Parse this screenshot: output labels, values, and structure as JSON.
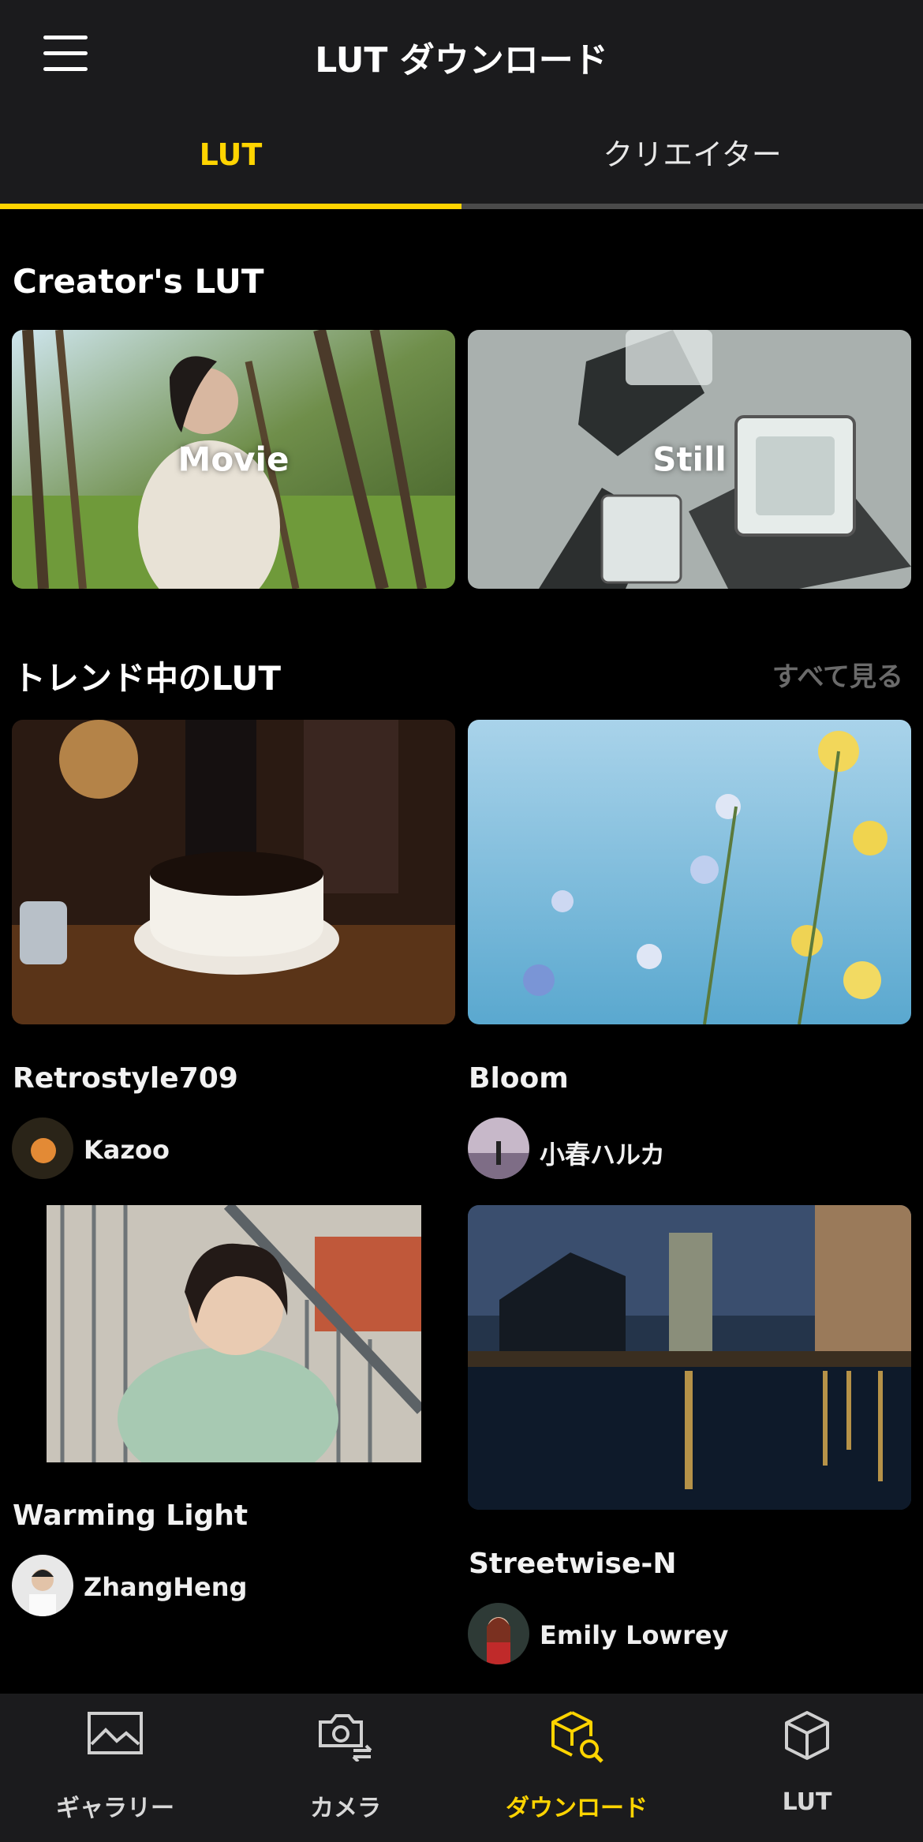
{
  "header": {
    "title": "LUT ダウンロード"
  },
  "tabs": [
    {
      "label": "LUT",
      "active": true
    },
    {
      "label": "クリエイター",
      "active": false
    }
  ],
  "creators_section": {
    "title": "Creator's LUT",
    "cards": [
      {
        "label": "Movie"
      },
      {
        "label": "Still"
      }
    ]
  },
  "trending_section": {
    "title": "トレンド中のLUT",
    "see_all": "すべて見る",
    "items": [
      {
        "name": "Retrostyle709",
        "author": "Kazoo"
      },
      {
        "name": "Bloom",
        "author": "小春ハルカ"
      },
      {
        "name": "Warming Light",
        "author": "ZhangHeng"
      },
      {
        "name": "Streetwise-N",
        "author": "Emily Lowrey"
      }
    ]
  },
  "bottom_nav": [
    {
      "label": "ギャラリー",
      "icon": "gallery-icon"
    },
    {
      "label": "カメラ",
      "icon": "camera-switch-icon"
    },
    {
      "label": "ダウンロード",
      "icon": "download-search-icon",
      "active": true
    },
    {
      "label": "LUT",
      "icon": "cube-icon"
    }
  ],
  "colors": {
    "accent": "#ffd400",
    "background": "#000000",
    "bar": "#1b1b1d"
  }
}
